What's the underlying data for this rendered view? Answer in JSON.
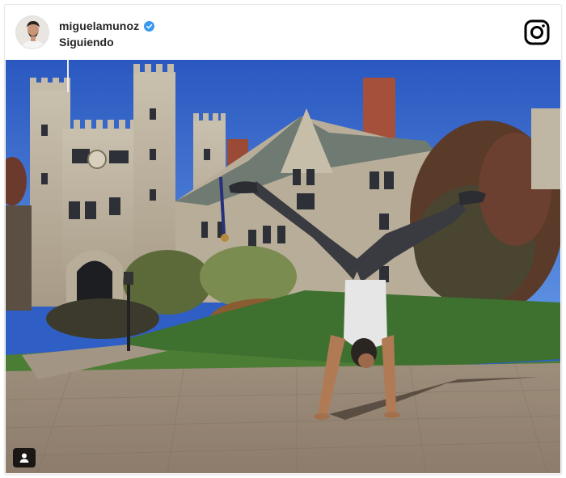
{
  "post": {
    "username": "miguelamunoz",
    "follow_status": "Siguiendo"
  },
  "icons": {
    "verified": "verified-badge-icon",
    "brand": "instagram-icon",
    "tag": "user-tag-icon"
  },
  "colors": {
    "verified_blue": "#3897f0",
    "text": "#262626",
    "sky": "#2f5fc4"
  }
}
